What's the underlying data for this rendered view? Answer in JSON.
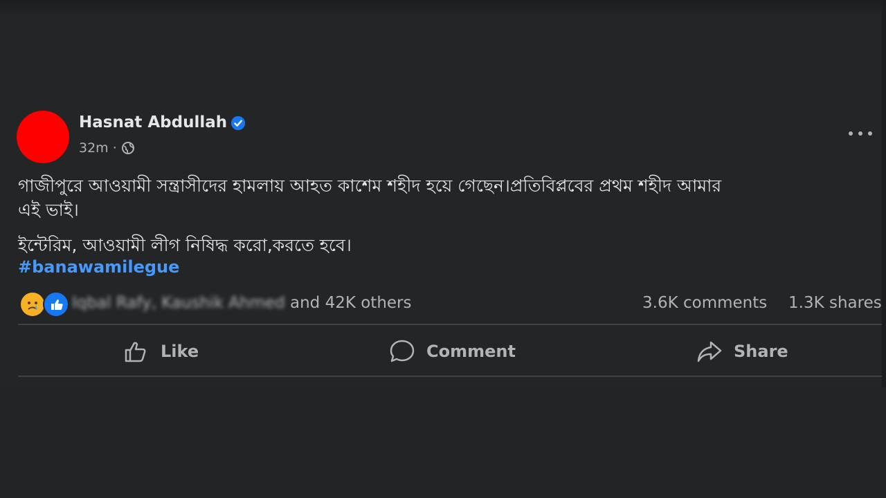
{
  "post": {
    "author": "Hasnat Abdullah",
    "time": "32m",
    "separator": "·",
    "body_line1": "গাজীপুরে আওয়ামী সন্ত্রাসীদের হামলায় আহত কাশেম শহীদ হয়ে গেছেন।প্রতিবিপ্লবের প্রথম শহীদ আমার",
    "body_line2": "এই ভাই।",
    "body_line3": "ইন্টেরিম, আওয়ামী লীগ নিষিদ্ধ করো,করতে হবে।",
    "hashtag": "#banawamilegue"
  },
  "stats": {
    "reactors_blurred": "Iqbal Rafy, Kaushik Ahmed",
    "reactors_rest": " and 42K others",
    "comments": "3.6K comments",
    "shares": "1.3K shares"
  },
  "actions": {
    "like": "Like",
    "comment": "Comment",
    "share": "Share"
  },
  "colors": {
    "background": "#242526",
    "avatar": "#ff0000",
    "hashtag": "#4599ff",
    "verified": "#1877f2"
  },
  "icons": [
    "verified-badge-icon",
    "globe-icon",
    "more-options-icon",
    "sad-reaction-icon",
    "like-reaction-icon",
    "thumbs-up-icon",
    "comment-bubble-icon",
    "share-arrow-icon"
  ]
}
